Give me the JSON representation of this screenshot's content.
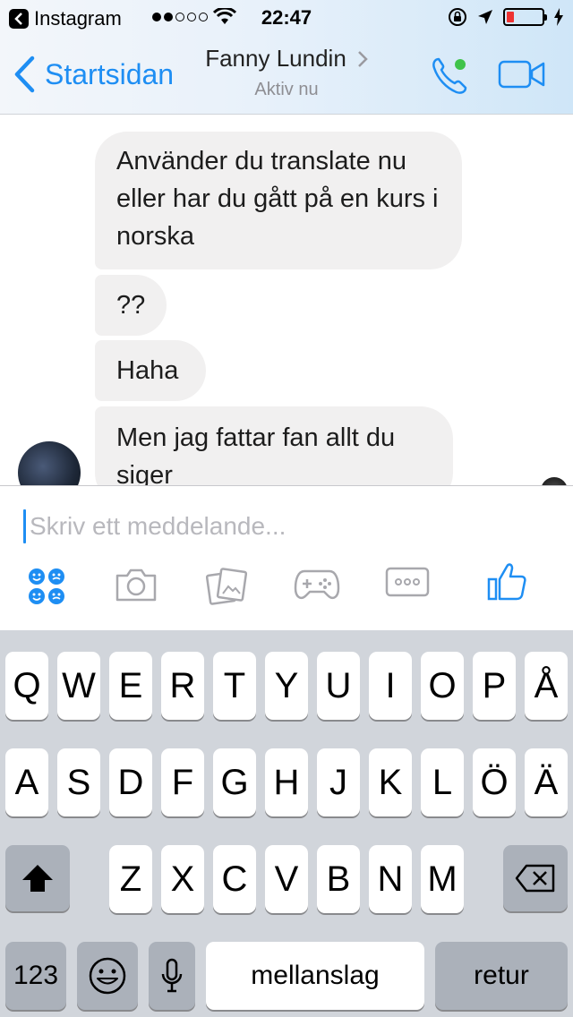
{
  "status_bar": {
    "back_app": "Instagram",
    "time": "22:47"
  },
  "nav": {
    "back_label": "Startsidan",
    "contact_name": "Fanny Lundin",
    "contact_status": "Aktiv nu",
    "icons": [
      "phone-icon",
      "video-camera-icon"
    ],
    "accent": "#1e8ef3",
    "online_color": "#3fc34a"
  },
  "messages": [
    {
      "sender": "contact",
      "text": "Använder du translate nu eller har du gått på en kurs i norska"
    },
    {
      "sender": "contact",
      "text": "??"
    },
    {
      "sender": "contact",
      "text": "Haha"
    },
    {
      "sender": "contact",
      "text": "Men jag fattar fan allt du siger"
    }
  ],
  "composer": {
    "placeholder": "Skriv ett meddelande...",
    "tools": [
      "stickers-icon",
      "camera-icon",
      "photo-gallery-icon",
      "gamepad-icon",
      "more-icon",
      "thumbs-up-icon"
    ]
  },
  "keyboard": {
    "row1": [
      "Q",
      "W",
      "E",
      "R",
      "T",
      "Y",
      "U",
      "I",
      "O",
      "P",
      "Å"
    ],
    "row2": [
      "A",
      "S",
      "D",
      "F",
      "G",
      "H",
      "J",
      "K",
      "L",
      "Ö",
      "Ä"
    ],
    "row3": [
      "Z",
      "X",
      "C",
      "V",
      "B",
      "N",
      "M"
    ],
    "numbers_key": "123",
    "space_key": "mellanslag",
    "return_key": "retur"
  }
}
